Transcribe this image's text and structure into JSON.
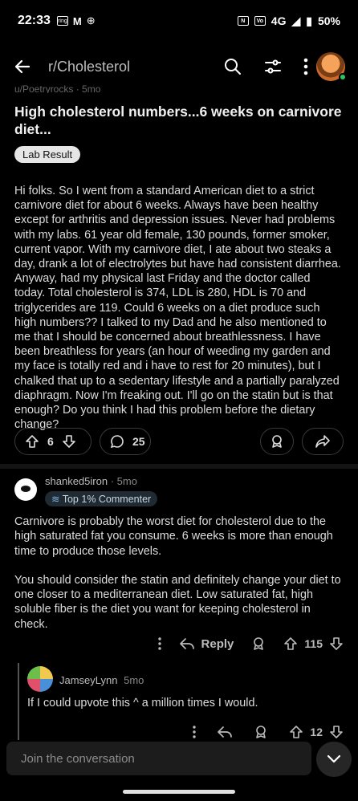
{
  "status_bar": {
    "time": "22:33",
    "icons_left": [
      "ring-icon",
      "gmail-icon",
      "data-saver-icon"
    ],
    "network": "4G",
    "battery": "50%"
  },
  "header": {
    "subreddit": "r/Cholesterol"
  },
  "post": {
    "faded_meta": "u/Poetryrocks · 5mo",
    "title": "High cholesterol numbers...6 weeks on carnivore diet...",
    "flair": "Lab Result",
    "body": "Hi folks. So I went from a standard American diet to a strict carnivore diet for about 6 weeks. Always have been healthy except for arthritis and depression issues. Never had problems with my labs. 61 year old female, 130 pounds, former smoker, current vapor. With my carnivore diet, I ate about two steaks a day, drank a lot of electrolytes but have had consistent diarrhea. Anyway, had my physical last Friday and the doctor called today. Total cholesterol is 374, LDL is 280, HDL is 70 and triglycerides are 119. Could 6 weeks on a diet produce such high numbers?? I talked to my Dad and he also mentioned to me that I should be concerned about breathlessness. I have been breathless for years (an hour of weeding my garden and my face is totally red and i have to rest for 20 minutes), but I chalked that up to a sedentary lifestyle and a partially paralyzed diaphragm. Now I'm freaking out. I'll go on the statin but is that enough? Do you think I had this problem before the dietary change?",
    "votes": "6",
    "comments": "25"
  },
  "comment1": {
    "username": "shanked5iron",
    "time": "5mo",
    "badge": "Top 1% Commenter",
    "paragraph1": "Carnivore is probably the worst diet for cholesterol due to the high saturated fat you consume. 6 weeks is more than enough time to produce those levels.",
    "paragraph2": "You should consider the statin and definitely change your diet to one closer to a mediterranean diet. Low saturated fat, high soluble fiber is the diet you want for keeping cholesterol in check.",
    "reply_label": "Reply",
    "votes": "115"
  },
  "comment2": {
    "username": "JamseyLynn",
    "time": "5mo",
    "body": "If I could upvote this ^ a million times I would.",
    "votes": "12"
  },
  "composer": {
    "placeholder": "Join the conversation"
  }
}
